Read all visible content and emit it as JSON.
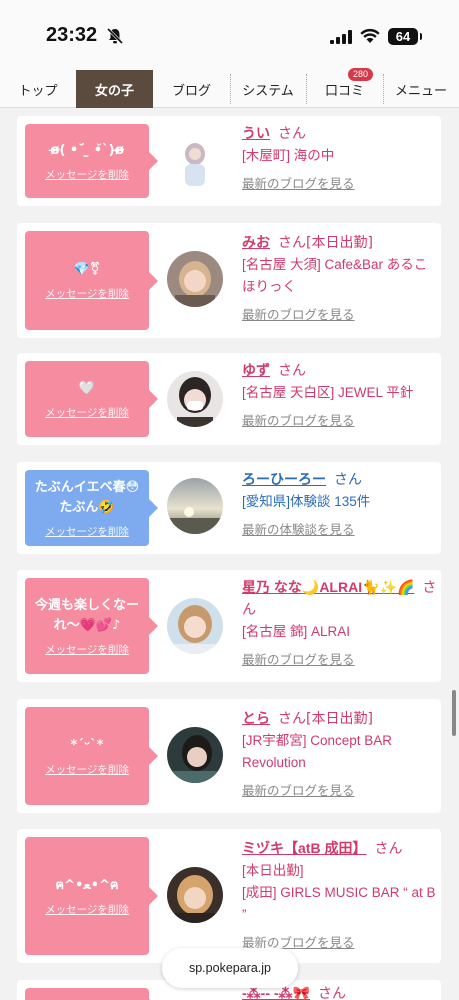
{
  "status": {
    "time": "23:32",
    "battery": "64"
  },
  "nav": {
    "items": [
      {
        "label": "トップ"
      },
      {
        "label": "女の子"
      },
      {
        "label": "ブログ"
      },
      {
        "label": "システム"
      },
      {
        "label": "口コミ",
        "badge": "280"
      },
      {
        "label": "メニュー"
      }
    ]
  },
  "cards": [
    {
      "message": "ɞ̴̶̷( •´̆ ̫ •̆`)ɞ̴̶̷",
      "delete": "メッセージを削除",
      "name": "うい",
      "san": "さん",
      "status_tag": "",
      "shop": "[木屋町] 海の中",
      "link": "最新のブログを見る"
    },
    {
      "message": "💎⚧",
      "delete": "メッセージを削除",
      "name": "みお",
      "san": "さん",
      "status_tag": "[本日出勤]",
      "shop": "[名古屋 大須] Cafe&Bar あるこほりっく",
      "link": "最新のブログを見る"
    },
    {
      "message": "🤍",
      "delete": "メッセージを削除",
      "name": "ゆず",
      "san": "さん",
      "status_tag": "",
      "shop": "[名古屋 天白区] JEWEL 平針",
      "link": "最新のブログを見る"
    },
    {
      "message": "たぶんイエベ春😳たぶん🤣",
      "delete": "メッセージを削除",
      "name": "ろーひーろー",
      "san": "さん",
      "status_tag": "",
      "shop": "[愛知県]体験談 135件",
      "link": "最新の体験談を見る"
    },
    {
      "message": "今週も楽しくなーれ〜💗💕♪",
      "delete": "メッセージを削除",
      "name": "星乃 なな🌙ALRAI🐈✨🌈",
      "san": "さん",
      "status_tag": "",
      "shop": "[名古屋 錦] ALRAI",
      "link": "最新のブログを見る"
    },
    {
      "message": "*ˊᵕˋ*",
      "delete": "メッセージを削除",
      "name": "とら",
      "san": "さん",
      "status_tag": "[本日出勤]",
      "shop": "[JR宇都宮] Concept BAR Revolution",
      "link": "最新のブログを見る"
    },
    {
      "message": "ฅ^•ﻌ•^ฅ",
      "delete": "メッセージを削除",
      "name": "ミヅキ【atB 成田】",
      "san": "さん",
      "status_tag": "",
      "status_tag2": "[本日出勤]",
      "shop": "[成田] GIRLS MUSIC BAR “ at B ”",
      "link": "最新のブログを見る"
    },
    {
      "message": "",
      "delete": "",
      "name": "-⁂-- -⁂🎀",
      "san": "さん",
      "status_tag": "",
      "shop": "",
      "link": ""
    }
  ],
  "url": "sp.pokepara.jp"
}
